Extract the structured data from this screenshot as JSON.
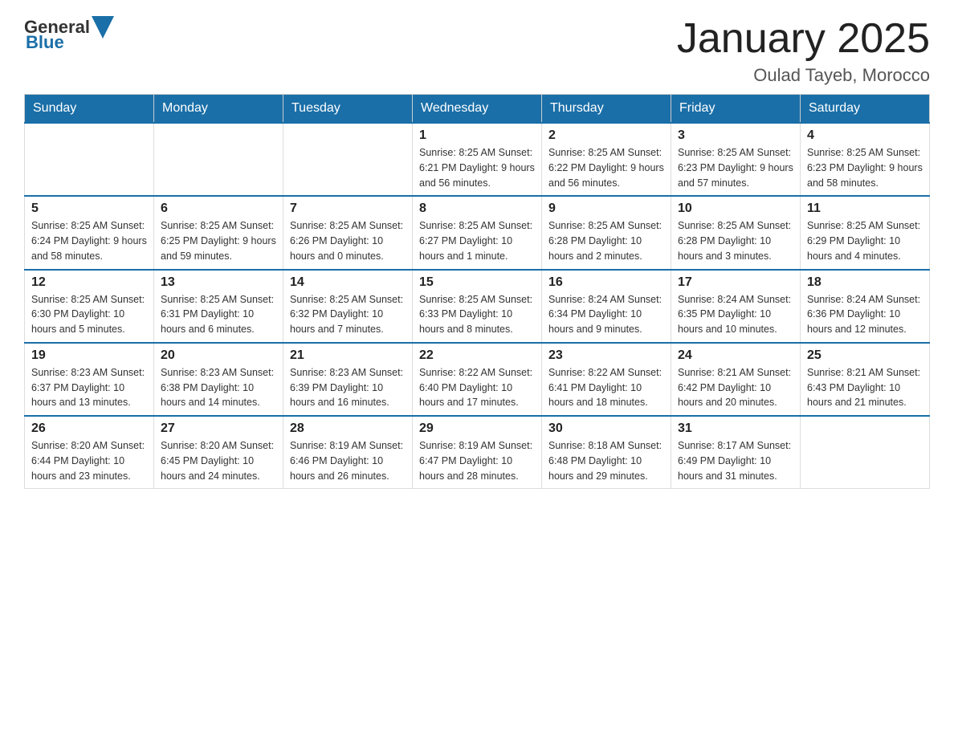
{
  "header": {
    "logo_general": "General",
    "logo_blue": "Blue",
    "month_year": "January 2025",
    "location": "Oulad Tayeb, Morocco"
  },
  "days_of_week": [
    "Sunday",
    "Monday",
    "Tuesday",
    "Wednesday",
    "Thursday",
    "Friday",
    "Saturday"
  ],
  "weeks": [
    [
      {
        "day": "",
        "info": ""
      },
      {
        "day": "",
        "info": ""
      },
      {
        "day": "",
        "info": ""
      },
      {
        "day": "1",
        "info": "Sunrise: 8:25 AM\nSunset: 6:21 PM\nDaylight: 9 hours and 56 minutes."
      },
      {
        "day": "2",
        "info": "Sunrise: 8:25 AM\nSunset: 6:22 PM\nDaylight: 9 hours and 56 minutes."
      },
      {
        "day": "3",
        "info": "Sunrise: 8:25 AM\nSunset: 6:23 PM\nDaylight: 9 hours and 57 minutes."
      },
      {
        "day": "4",
        "info": "Sunrise: 8:25 AM\nSunset: 6:23 PM\nDaylight: 9 hours and 58 minutes."
      }
    ],
    [
      {
        "day": "5",
        "info": "Sunrise: 8:25 AM\nSunset: 6:24 PM\nDaylight: 9 hours and 58 minutes."
      },
      {
        "day": "6",
        "info": "Sunrise: 8:25 AM\nSunset: 6:25 PM\nDaylight: 9 hours and 59 minutes."
      },
      {
        "day": "7",
        "info": "Sunrise: 8:25 AM\nSunset: 6:26 PM\nDaylight: 10 hours and 0 minutes."
      },
      {
        "day": "8",
        "info": "Sunrise: 8:25 AM\nSunset: 6:27 PM\nDaylight: 10 hours and 1 minute."
      },
      {
        "day": "9",
        "info": "Sunrise: 8:25 AM\nSunset: 6:28 PM\nDaylight: 10 hours and 2 minutes."
      },
      {
        "day": "10",
        "info": "Sunrise: 8:25 AM\nSunset: 6:28 PM\nDaylight: 10 hours and 3 minutes."
      },
      {
        "day": "11",
        "info": "Sunrise: 8:25 AM\nSunset: 6:29 PM\nDaylight: 10 hours and 4 minutes."
      }
    ],
    [
      {
        "day": "12",
        "info": "Sunrise: 8:25 AM\nSunset: 6:30 PM\nDaylight: 10 hours and 5 minutes."
      },
      {
        "day": "13",
        "info": "Sunrise: 8:25 AM\nSunset: 6:31 PM\nDaylight: 10 hours and 6 minutes."
      },
      {
        "day": "14",
        "info": "Sunrise: 8:25 AM\nSunset: 6:32 PM\nDaylight: 10 hours and 7 minutes."
      },
      {
        "day": "15",
        "info": "Sunrise: 8:25 AM\nSunset: 6:33 PM\nDaylight: 10 hours and 8 minutes."
      },
      {
        "day": "16",
        "info": "Sunrise: 8:24 AM\nSunset: 6:34 PM\nDaylight: 10 hours and 9 minutes."
      },
      {
        "day": "17",
        "info": "Sunrise: 8:24 AM\nSunset: 6:35 PM\nDaylight: 10 hours and 10 minutes."
      },
      {
        "day": "18",
        "info": "Sunrise: 8:24 AM\nSunset: 6:36 PM\nDaylight: 10 hours and 12 minutes."
      }
    ],
    [
      {
        "day": "19",
        "info": "Sunrise: 8:23 AM\nSunset: 6:37 PM\nDaylight: 10 hours and 13 minutes."
      },
      {
        "day": "20",
        "info": "Sunrise: 8:23 AM\nSunset: 6:38 PM\nDaylight: 10 hours and 14 minutes."
      },
      {
        "day": "21",
        "info": "Sunrise: 8:23 AM\nSunset: 6:39 PM\nDaylight: 10 hours and 16 minutes."
      },
      {
        "day": "22",
        "info": "Sunrise: 8:22 AM\nSunset: 6:40 PM\nDaylight: 10 hours and 17 minutes."
      },
      {
        "day": "23",
        "info": "Sunrise: 8:22 AM\nSunset: 6:41 PM\nDaylight: 10 hours and 18 minutes."
      },
      {
        "day": "24",
        "info": "Sunrise: 8:21 AM\nSunset: 6:42 PM\nDaylight: 10 hours and 20 minutes."
      },
      {
        "day": "25",
        "info": "Sunrise: 8:21 AM\nSunset: 6:43 PM\nDaylight: 10 hours and 21 minutes."
      }
    ],
    [
      {
        "day": "26",
        "info": "Sunrise: 8:20 AM\nSunset: 6:44 PM\nDaylight: 10 hours and 23 minutes."
      },
      {
        "day": "27",
        "info": "Sunrise: 8:20 AM\nSunset: 6:45 PM\nDaylight: 10 hours and 24 minutes."
      },
      {
        "day": "28",
        "info": "Sunrise: 8:19 AM\nSunset: 6:46 PM\nDaylight: 10 hours and 26 minutes."
      },
      {
        "day": "29",
        "info": "Sunrise: 8:19 AM\nSunset: 6:47 PM\nDaylight: 10 hours and 28 minutes."
      },
      {
        "day": "30",
        "info": "Sunrise: 8:18 AM\nSunset: 6:48 PM\nDaylight: 10 hours and 29 minutes."
      },
      {
        "day": "31",
        "info": "Sunrise: 8:17 AM\nSunset: 6:49 PM\nDaylight: 10 hours and 31 minutes."
      },
      {
        "day": "",
        "info": ""
      }
    ]
  ]
}
